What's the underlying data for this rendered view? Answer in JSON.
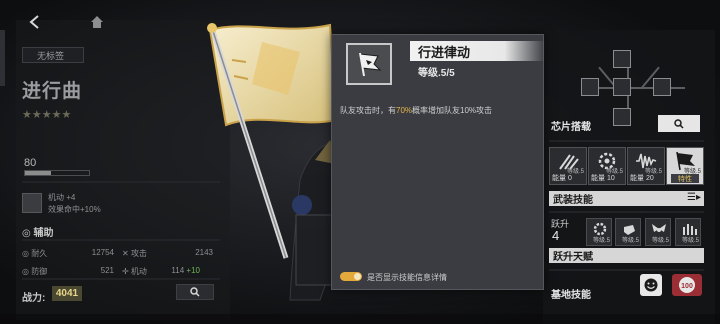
{
  "nav": {
    "back_icon": "back-arrow-icon",
    "home_icon": "home-icon"
  },
  "left_panel": {
    "tag": "无标签",
    "weapon_name": "进行曲",
    "stars": "★★★★★",
    "level": "80",
    "level_progress": 0.4,
    "bonus_lines": [
      "机动 +4",
      "效果命中+10%"
    ],
    "section_aux": "辅助",
    "attributes": [
      {
        "name": "耐久",
        "value": "12754"
      },
      {
        "name": "攻击",
        "value": "2143"
      },
      {
        "name": "防御",
        "value": "521"
      },
      {
        "name": "机动",
        "value": "114",
        "bonus": "+10"
      }
    ],
    "power_label": "战力:",
    "power_value": "4041"
  },
  "popup": {
    "title": "行进律动",
    "level": "等级.5/5",
    "desc_prefix": "队友攻击时，有",
    "desc_highlight": "70%",
    "desc_suffix": "概率增加队友10%攻击",
    "toggle_on": true,
    "toggle_label": "是否显示技能信息详情"
  },
  "right_panel": {
    "chip_label": "芯片搭载",
    "armament": [
      {
        "level": "等级.5",
        "cost": "能量 0",
        "icon": "claw-slash-icon"
      },
      {
        "level": "等级.5",
        "cost": "能量 10",
        "icon": "gear-ring-icon"
      },
      {
        "level": "等级.5",
        "cost": "能量 20",
        "icon": "soundwave-icon"
      },
      {
        "level": "等级.5",
        "cost": "特性",
        "icon": "flag-icon",
        "trait": true
      }
    ],
    "armament_label": "武装技能",
    "leap_label": "跃升",
    "leap_level": "4",
    "leap_skills": [
      {
        "level": "等级.5",
        "icon": "gear-icon"
      },
      {
        "level": "等级.5",
        "icon": "fist-icon"
      },
      {
        "level": "等级.5",
        "icon": "wings-icon"
      },
      {
        "level": "等级.5",
        "icon": "bars-icon"
      }
    ],
    "leap_title": "跃升天赋",
    "base_label": "基地技能",
    "base_badge": "100"
  },
  "colors": {
    "accent_gold": "#e5b64b",
    "toggle_on": "#e3a93a",
    "bonus_green": "#6fb35a"
  }
}
